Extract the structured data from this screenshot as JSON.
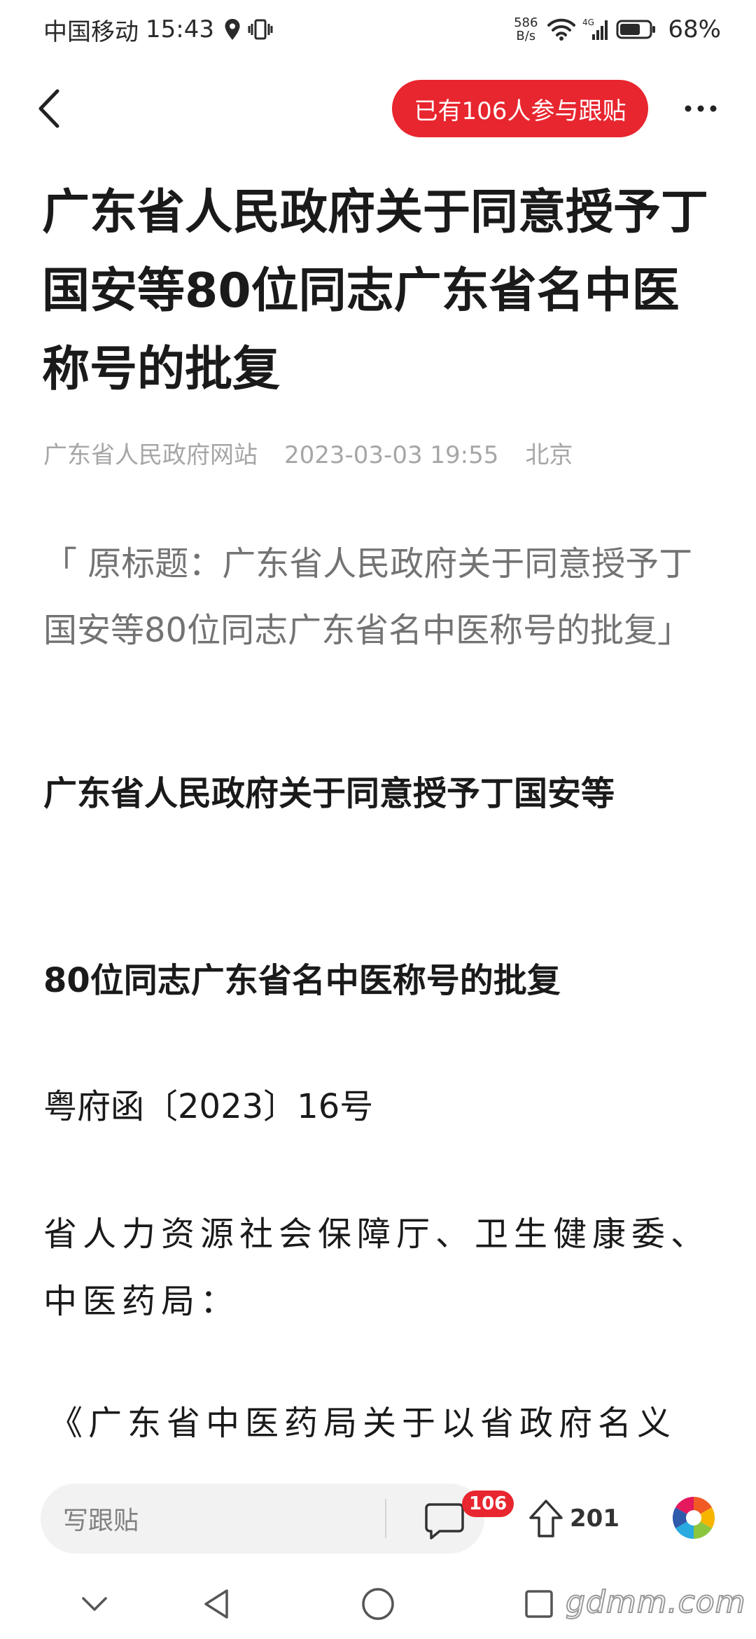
{
  "status_bar": {
    "carrier": "中国移动",
    "time": "15:43",
    "net_speed_value": "586",
    "net_speed_unit": "B/s",
    "network_type": "4G",
    "battery": "68%"
  },
  "top_nav": {
    "follow_badge": "已有106人参与跟贴"
  },
  "article": {
    "title": "广东省人民政府关于同意授予丁国安等80位同志广东省名中医称号的批复",
    "source": "广东省人民政府网站",
    "datetime": "2023-03-03 19:55",
    "location": "北京",
    "original_title": "「 原标题：广东省人民政府关于同意授予丁国安等80位同志广东省名中医称号的批复」",
    "heading_1": "广东省人民政府关于同意授予丁国安等",
    "heading_2": "80位同志广东省名中医称号的批复",
    "doc_number": "粤府函〔2023〕16号",
    "addressees": "省人力资源社会保障厅、卫生健康委、中医药局：",
    "body_start": "《广东省中医药局关于以省政府名义"
  },
  "action_bar": {
    "comment_placeholder": "写跟贴",
    "comment_count": "106",
    "share_count": "201"
  },
  "watermark": "gdmm.com",
  "colors": {
    "accent_red": "#e8262f",
    "meta_gray": "#a6a6a6",
    "text_dark": "#1a1a1a"
  },
  "icons": [
    "location-icon",
    "vibrate-icon",
    "wifi-icon",
    "signal-icon",
    "battery-icon",
    "back-arrow-icon",
    "more-dots-icon",
    "comment-bubble-icon",
    "share-arrow-icon",
    "app-logo-icon",
    "hide-keyboard-icon",
    "back-triangle-icon",
    "home-circle-icon",
    "recents-square-icon"
  ]
}
